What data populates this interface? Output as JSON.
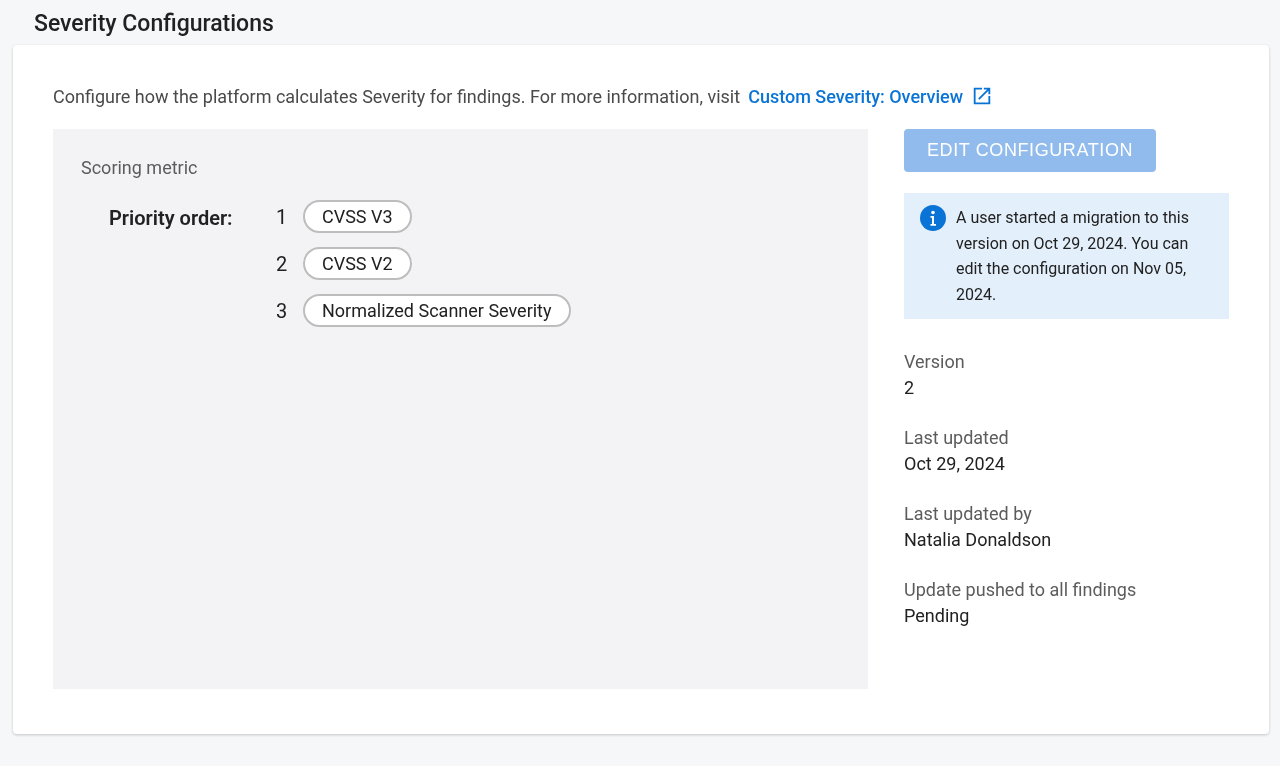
{
  "title": "Severity Configurations",
  "intro": {
    "text": "Configure how the platform calculates Severity for findings. For more information, visit",
    "link": "Custom Severity: Overview"
  },
  "scoring": {
    "label": "Scoring metric",
    "priority_label": "Priority order:",
    "items": [
      {
        "rank": "1",
        "name": "CVSS V3"
      },
      {
        "rank": "2",
        "name": "CVSS V2"
      },
      {
        "rank": "3",
        "name": "Normalized Scanner Severity"
      }
    ]
  },
  "edit_button": {
    "label": "EDIT CONFIGURATION",
    "disabled": true
  },
  "notice": "A user started a migration to this version on Oct 29, 2024. You can edit the configuration on Nov 05, 2024.",
  "details": [
    {
      "label": "Version",
      "value": "2"
    },
    {
      "label": "Last updated",
      "value": "Oct 29, 2024"
    },
    {
      "label": "Last updated by",
      "value": "Natalia Donaldson"
    },
    {
      "label": "Update pushed to all findings",
      "value": "Pending"
    }
  ]
}
